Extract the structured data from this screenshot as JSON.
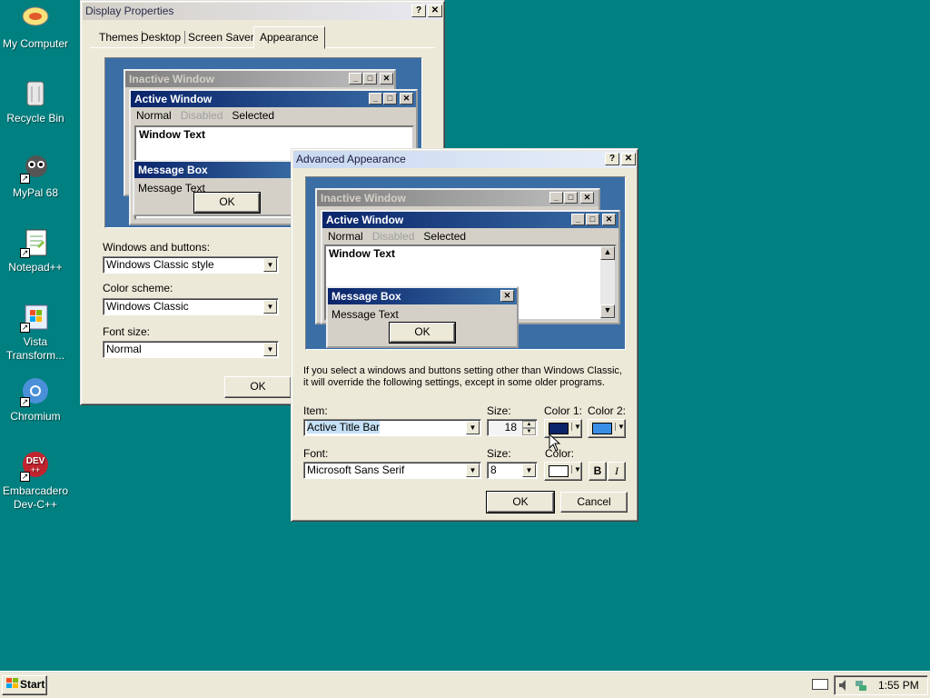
{
  "desktop": {
    "icons": [
      {
        "label": "My Computer",
        "icon": "my-computer-icon"
      },
      {
        "label": "Recycle Bin",
        "icon": "recycle-bin-icon"
      },
      {
        "label": "MyPal 68",
        "icon": "mypal-icon"
      },
      {
        "label": "Notepad++",
        "icon": "notepad-plus-plus-icon"
      },
      {
        "label": "Vista Transform...",
        "icon": "vista-transform-icon"
      },
      {
        "label": "Chromium",
        "icon": "chromium-icon"
      },
      {
        "label": "Embarcadero Dev-C++",
        "icon": "devcpp-icon"
      }
    ]
  },
  "display": {
    "title": "Display Properties",
    "tabs": [
      "Themes",
      "Desktop",
      "Screen Saver",
      "Appearance"
    ],
    "preview": {
      "inactive": "Inactive Window",
      "active": "Active Window",
      "menu": [
        "Normal",
        "Disabled",
        "Selected"
      ],
      "window_text": "Window Text",
      "msgbox": "Message Box",
      "msg_text": "Message Text",
      "ok": "OK"
    },
    "windows_buttons_label": "Windows and buttons:",
    "windows_buttons_value": "Windows Classic style",
    "color_scheme_label": "Color scheme:",
    "color_scheme_value": "Windows Classic",
    "font_size_label": "Font size:",
    "font_size_value": "Normal",
    "ok": "OK"
  },
  "advanced": {
    "title": "Advanced Appearance",
    "preview": {
      "inactive": "Inactive Window",
      "active": "Active Window",
      "menu": [
        "Normal",
        "Disabled",
        "Selected"
      ],
      "window_text": "Window Text",
      "msgbox": "Message Box",
      "msg_text": "Message Text",
      "ok": "OK"
    },
    "info1": "If you select a windows and buttons setting other than Windows Classic,",
    "info2": "it will override the following settings, except in some older programs.",
    "item_label": "Item:",
    "item_value": "Active Title Bar",
    "size_label": "Size:",
    "size_value": "18",
    "color1_label": "Color 1:",
    "color2_label": "Color 2:",
    "font_label": "Font:",
    "font_value": "Microsoft Sans Serif",
    "fsize_label": "Size:",
    "fsize_value": "8",
    "fcolor_label": "Color:",
    "bold": "B",
    "italic": "I",
    "ok": "OK",
    "cancel": "Cancel",
    "color1": "#0a246a",
    "color2": "#3a8ee6"
  },
  "taskbar": {
    "start": "Start",
    "clock": "1:55 PM"
  }
}
